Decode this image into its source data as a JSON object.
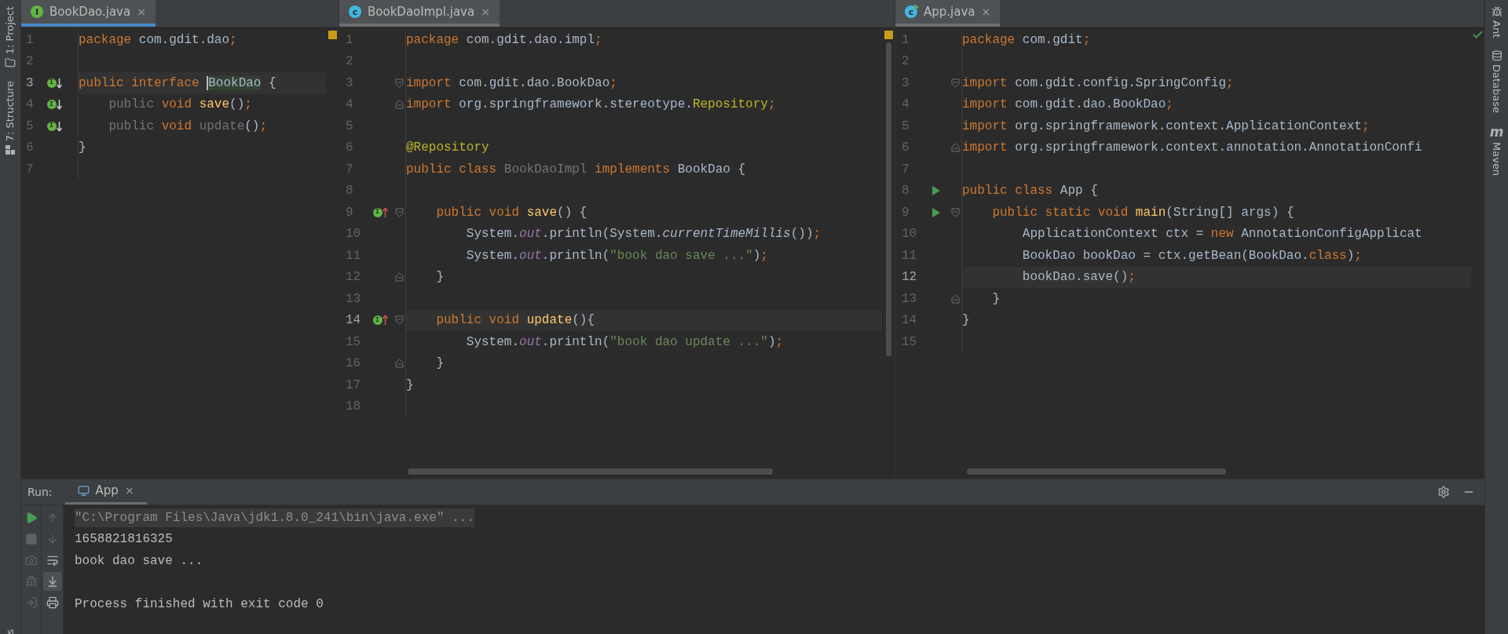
{
  "left_strip": [
    {
      "label": "1: Project",
      "kind": "folder"
    },
    {
      "label": "7: Structure",
      "kind": "structure"
    },
    {
      "label": "s",
      "kind": "plain"
    }
  ],
  "panes": [
    {
      "tab": {
        "title": "BookDao.java",
        "kind": "interface",
        "badge": "I",
        "close": "×",
        "focused": true
      },
      "indicator": {
        "kind": "warning"
      },
      "lines": [
        {
          "n": "1",
          "tokens": [
            {
              "t": "package ",
              "kind": "kw"
            },
            {
              "t": "com.gdit.dao",
              "kind": "plain"
            },
            {
              "t": ";",
              "kind": "kw"
            }
          ]
        },
        {
          "n": "2"
        },
        {
          "n": "3",
          "current": true,
          "marker": {
            "kind": "implemented",
            "badge": "I"
          },
          "tokens": [
            {
              "t": "public interface ",
              "kind": "kw"
            },
            {
              "t": "BookDao",
              "kind": "caret"
            },
            {
              "t": " {",
              "kind": "plain"
            }
          ]
        },
        {
          "n": "4",
          "marker": {
            "kind": "implemented",
            "badge": "I"
          },
          "tokens": [
            {
              "t": "    public ",
              "kind": "dim"
            },
            {
              "t": "void ",
              "kind": "kw"
            },
            {
              "t": "save",
              "kind": "method"
            },
            {
              "t": "()",
              "kind": "plain"
            },
            {
              "t": ";",
              "kind": "kw"
            }
          ]
        },
        {
          "n": "5",
          "marker": {
            "kind": "implemented",
            "badge": "I"
          },
          "tokens": [
            {
              "t": "    public ",
              "kind": "dim"
            },
            {
              "t": "void ",
              "kind": "kw"
            },
            {
              "t": "update",
              "kind": "dim"
            },
            {
              "t": "()",
              "kind": "plain"
            },
            {
              "t": ";",
              "kind": "kw"
            }
          ]
        },
        {
          "n": "6",
          "tokens": [
            {
              "t": "}",
              "kind": "plain"
            }
          ]
        },
        {
          "n": "7"
        }
      ]
    },
    {
      "tab": {
        "title": "BookDaoImpl.java",
        "kind": "class",
        "badge": "c",
        "close": "×",
        "focused": false
      },
      "indicator": {
        "kind": "warning"
      },
      "lines": [
        {
          "n": "1",
          "tokens": [
            {
              "t": "package ",
              "kind": "kw"
            },
            {
              "t": "com.gdit.dao.impl",
              "kind": "plain"
            },
            {
              "t": ";",
              "kind": "kw"
            }
          ]
        },
        {
          "n": "2"
        },
        {
          "n": "3",
          "fold": {
            "kind": "start"
          },
          "tokens": [
            {
              "t": "import ",
              "kind": "kw"
            },
            {
              "t": "com.gdit.dao.BookDao",
              "kind": "plain"
            },
            {
              "t": ";",
              "kind": "kw"
            }
          ]
        },
        {
          "n": "4",
          "fold": {
            "kind": "end"
          },
          "tokens": [
            {
              "t": "import ",
              "kind": "kw"
            },
            {
              "t": "org.springframework.stereotype.",
              "kind": "plain"
            },
            {
              "t": "Repository",
              "kind": "annotation"
            },
            {
              "t": ";",
              "kind": "kw"
            }
          ]
        },
        {
          "n": "5"
        },
        {
          "n": "6",
          "tokens": [
            {
              "t": "@Repository",
              "kind": "annotation"
            }
          ]
        },
        {
          "n": "7",
          "tokens": [
            {
              "t": "public class ",
              "kind": "kw"
            },
            {
              "t": "BookDaoImpl ",
              "kind": "dim"
            },
            {
              "t": "implements ",
              "kind": "kw"
            },
            {
              "t": "BookDao {",
              "kind": "plain"
            }
          ]
        },
        {
          "n": "8"
        },
        {
          "n": "9",
          "fold": {
            "kind": "start"
          },
          "marker": {
            "kind": "implementing",
            "badge": "I"
          },
          "tokens": [
            {
              "t": "    public void ",
              "kind": "kw"
            },
            {
              "t": "save",
              "kind": "method"
            },
            {
              "t": "() {",
              "kind": "plain"
            }
          ]
        },
        {
          "n": "10",
          "tokens": [
            {
              "t": "        System.",
              "kind": "plain"
            },
            {
              "t": "out",
              "kind": "field"
            },
            {
              "t": ".println(System.",
              "kind": "plain"
            },
            {
              "t": "currentTimeMillis",
              "kind": "static"
            },
            {
              "t": "())",
              "kind": "plain"
            },
            {
              "t": ";",
              "kind": "kw"
            }
          ]
        },
        {
          "n": "11",
          "tokens": [
            {
              "t": "        System.",
              "kind": "plain"
            },
            {
              "t": "out",
              "kind": "field"
            },
            {
              "t": ".println(",
              "kind": "plain"
            },
            {
              "t": "\"book dao save ...\"",
              "kind": "string"
            },
            {
              "t": ")",
              "kind": "plain"
            },
            {
              "t": ";",
              "kind": "kw"
            }
          ]
        },
        {
          "n": "12",
          "fold": {
            "kind": "end"
          },
          "tokens": [
            {
              "t": "    }",
              "kind": "plain"
            }
          ]
        },
        {
          "n": "13"
        },
        {
          "n": "14",
          "current": true,
          "fold": {
            "kind": "start"
          },
          "marker": {
            "kind": "implementing",
            "badge": "I"
          },
          "tokens": [
            {
              "t": "    public void ",
              "kind": "kw"
            },
            {
              "t": "update",
              "kind": "method"
            },
            {
              "t": "(){",
              "kind": "plain"
            }
          ]
        },
        {
          "n": "15",
          "tokens": [
            {
              "t": "        System.",
              "kind": "plain"
            },
            {
              "t": "out",
              "kind": "field"
            },
            {
              "t": ".println(",
              "kind": "plain"
            },
            {
              "t": "\"book dao update ...\"",
              "kind": "string"
            },
            {
              "t": ")",
              "kind": "plain"
            },
            {
              "t": ";",
              "kind": "kw"
            }
          ]
        },
        {
          "n": "16",
          "fold": {
            "kind": "end"
          },
          "tokens": [
            {
              "t": "    }",
              "kind": "plain"
            }
          ]
        },
        {
          "n": "17",
          "tokens": [
            {
              "t": "}",
              "kind": "plain"
            }
          ]
        },
        {
          "n": "18"
        }
      ]
    },
    {
      "tab": {
        "title": "App.java",
        "kind": "runnable",
        "badge": "c",
        "close": "×",
        "focused": false
      },
      "indicator": {
        "kind": "ok"
      },
      "lines": [
        {
          "n": "1",
          "tokens": [
            {
              "t": "package ",
              "kind": "kw"
            },
            {
              "t": "com.gdit",
              "kind": "plain"
            },
            {
              "t": ";",
              "kind": "kw"
            }
          ]
        },
        {
          "n": "2"
        },
        {
          "n": "3",
          "fold": {
            "kind": "start"
          },
          "tokens": [
            {
              "t": "import ",
              "kind": "kw"
            },
            {
              "t": "com.gdit.config.SpringConfig",
              "kind": "plain"
            },
            {
              "t": ";",
              "kind": "kw"
            }
          ]
        },
        {
          "n": "4",
          "tokens": [
            {
              "t": "import ",
              "kind": "kw"
            },
            {
              "t": "com.gdit.dao.BookDao",
              "kind": "plain"
            },
            {
              "t": ";",
              "kind": "kw"
            }
          ]
        },
        {
          "n": "5",
          "tokens": [
            {
              "t": "import ",
              "kind": "kw"
            },
            {
              "t": "org.springframework.context.ApplicationContext",
              "kind": "plain"
            },
            {
              "t": ";",
              "kind": "kw"
            }
          ]
        },
        {
          "n": "6",
          "fold": {
            "kind": "end"
          },
          "tokens": [
            {
              "t": "import ",
              "kind": "kw"
            },
            {
              "t": "org.springframework.context.annotation.AnnotationConfi",
              "kind": "plain"
            }
          ]
        },
        {
          "n": "7"
        },
        {
          "n": "8",
          "marker": {
            "kind": "run"
          },
          "tokens": [
            {
              "t": "public class ",
              "kind": "kw"
            },
            {
              "t": "App {",
              "kind": "plain"
            }
          ]
        },
        {
          "n": "9",
          "fold": {
            "kind": "start"
          },
          "marker": {
            "kind": "run"
          },
          "tokens": [
            {
              "t": "    public static void ",
              "kind": "kw"
            },
            {
              "t": "main",
              "kind": "method"
            },
            {
              "t": "(String[] args) {",
              "kind": "plain"
            }
          ]
        },
        {
          "n": "10",
          "tokens": [
            {
              "t": "        ApplicationContext ctx = ",
              "kind": "plain"
            },
            {
              "t": "new ",
              "kind": "kw"
            },
            {
              "t": "AnnotationConfigApplicat",
              "kind": "plain"
            }
          ]
        },
        {
          "n": "11",
          "tokens": [
            {
              "t": "        BookDao bookDao = ctx.getBean(BookDao.",
              "kind": "plain"
            },
            {
              "t": "class",
              "kind": "kw"
            },
            {
              "t": ")",
              "kind": "plain"
            },
            {
              "t": ";",
              "kind": "kw"
            }
          ]
        },
        {
          "n": "12",
          "current": true,
          "tokens": [
            {
              "t": "        bookDao.save()",
              "kind": "plain"
            },
            {
              "t": ";",
              "kind": "kw"
            }
          ]
        },
        {
          "n": "13",
          "fold": {
            "kind": "end"
          },
          "tokens": [
            {
              "t": "    }",
              "kind": "plain"
            }
          ]
        },
        {
          "n": "14",
          "tokens": [
            {
              "t": "}",
              "kind": "plain"
            }
          ]
        },
        {
          "n": "15"
        }
      ]
    }
  ],
  "run_panel": {
    "label": "Run:",
    "tab": {
      "title": "App",
      "close": "×"
    },
    "toolbar_left": [
      {
        "kind": "run",
        "disabled": false
      },
      {
        "kind": "stop",
        "disabled": true
      },
      {
        "kind": "camera",
        "disabled": true
      },
      {
        "kind": "bug",
        "disabled": true
      },
      {
        "kind": "exit",
        "disabled": true
      }
    ],
    "toolbar_right": [
      {
        "kind": "up",
        "disabled": true,
        "selected": false
      },
      {
        "kind": "down",
        "disabled": true,
        "selected": false
      },
      {
        "kind": "wrap",
        "disabled": false,
        "selected": false
      },
      {
        "kind": "scroll-end",
        "disabled": false,
        "selected": true
      },
      {
        "kind": "print",
        "disabled": false,
        "selected": false
      }
    ],
    "console": [
      {
        "kind": "command",
        "text": "\"C:\\Program Files\\Java\\jdk1.8.0_241\\bin\\java.exe\" ..."
      },
      {
        "kind": "output",
        "text": "1658821816325"
      },
      {
        "kind": "output",
        "text": "book dao save ..."
      },
      {
        "kind": "blank"
      },
      {
        "kind": "output",
        "text": "Process finished with exit code 0"
      }
    ]
  },
  "right_strip": [
    {
      "label": "Ant",
      "kind": "bug"
    },
    {
      "label": "Database",
      "kind": "database"
    },
    {
      "label": "Maven",
      "kind": "text",
      "icon_text": "m"
    }
  ]
}
